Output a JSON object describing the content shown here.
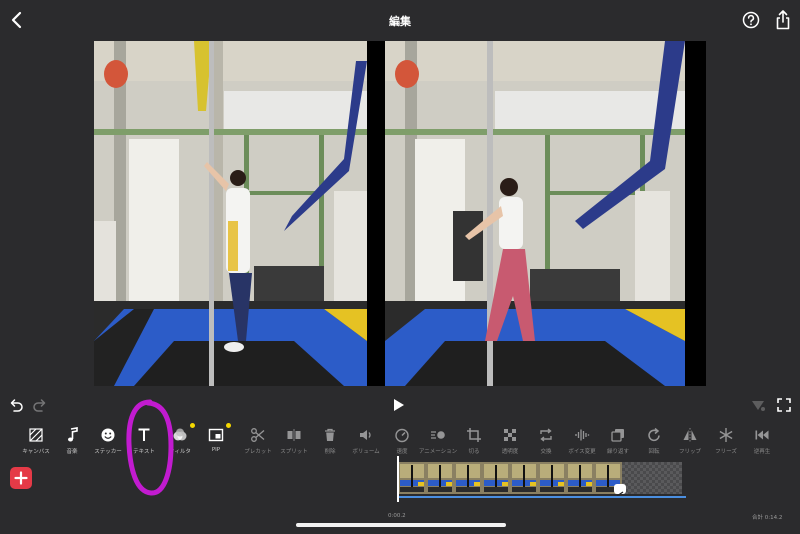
{
  "header": {
    "title": "編集"
  },
  "toolbar": {
    "tools": [
      {
        "label": "キャンバス",
        "icon": "canvas-icon"
      },
      {
        "label": "音楽",
        "icon": "music-note-icon"
      },
      {
        "label": "ステッカー",
        "icon": "smiley-icon"
      },
      {
        "label": "テキスト",
        "icon": "text-icon"
      },
      {
        "label": "フィルタ",
        "icon": "filter-icon"
      },
      {
        "label": "PIP",
        "icon": "pip-icon"
      },
      {
        "label": "プレカット",
        "icon": "scissors-icon"
      },
      {
        "label": "スプリット",
        "icon": "split-icon"
      },
      {
        "label": "削除",
        "icon": "trash-icon"
      },
      {
        "label": "ボリューム",
        "icon": "volume-icon"
      },
      {
        "label": "速度",
        "icon": "speed-icon"
      },
      {
        "label": "アニメーション",
        "icon": "animation-icon"
      },
      {
        "label": "切る",
        "icon": "crop-icon"
      },
      {
        "label": "透明度",
        "icon": "opacity-icon"
      },
      {
        "label": "交換",
        "icon": "replace-icon"
      },
      {
        "label": "ボイス変更",
        "icon": "voice-wave-icon"
      },
      {
        "label": "繰り返す",
        "icon": "duplicate-icon"
      },
      {
        "label": "回転",
        "icon": "rotate-icon"
      },
      {
        "label": "フリップ",
        "icon": "flip-icon"
      },
      {
        "label": "フリーズ",
        "icon": "snowflake-icon"
      },
      {
        "label": "逆再生",
        "icon": "reverse-icon"
      }
    ]
  },
  "timeline": {
    "current_time": "0:00.2",
    "total_time": "合計 0:14.2"
  },
  "colors": {
    "accent_add": "#e53a47",
    "highlight": "#c21bd0",
    "notify_dot": "#f5d800",
    "track": "#4b8fe0"
  }
}
